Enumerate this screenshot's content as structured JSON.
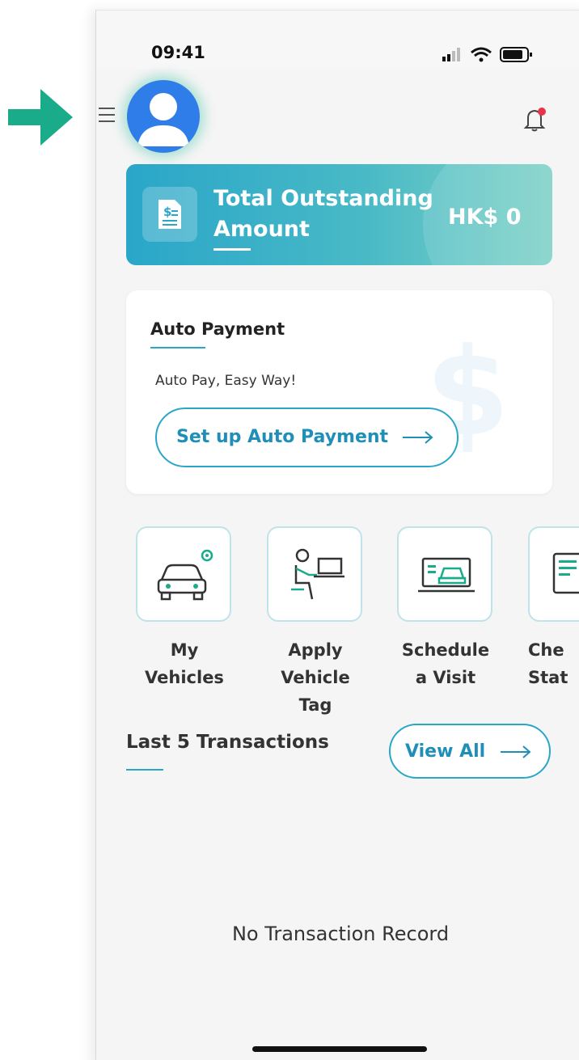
{
  "status_bar": {
    "time": "09:41"
  },
  "header": {
    "menu_icon": "menu-icon",
    "avatar_icon": "user-avatar-icon",
    "bell_icon": "bell-icon",
    "bell_badge_color": "#e8334a"
  },
  "outstanding": {
    "title": "Total Outstanding Amount",
    "amount": "HK$ 0",
    "icon": "bill-document-icon",
    "gradient": [
      "#2aa6c9",
      "#7fd2c6"
    ]
  },
  "auto_payment": {
    "title": "Auto Payment",
    "subtitle": "Auto Pay, Easy Way!",
    "button_label": "Set up Auto Payment",
    "background_icon": "dollar-icon"
  },
  "quick_actions": [
    {
      "label_line1": "My",
      "label_line2": "Vehicles",
      "icon": "car-settings-icon"
    },
    {
      "label_line1": "Apply",
      "label_line2": "Vehicle Tag",
      "icon": "person-laptop-icon"
    },
    {
      "label_line1": "Schedule",
      "label_line2": "a Visit",
      "icon": "vehicle-screen-icon"
    },
    {
      "label_line1": "Che",
      "label_line2": "Stat",
      "icon": "document-tap-icon"
    }
  ],
  "transactions": {
    "title": "Last 5 Transactions",
    "view_all_label": "View All",
    "empty_text": "No Transaction Record"
  },
  "accent_color": "#2aa6c9",
  "pointer_arrow_color": "#1aab8b"
}
